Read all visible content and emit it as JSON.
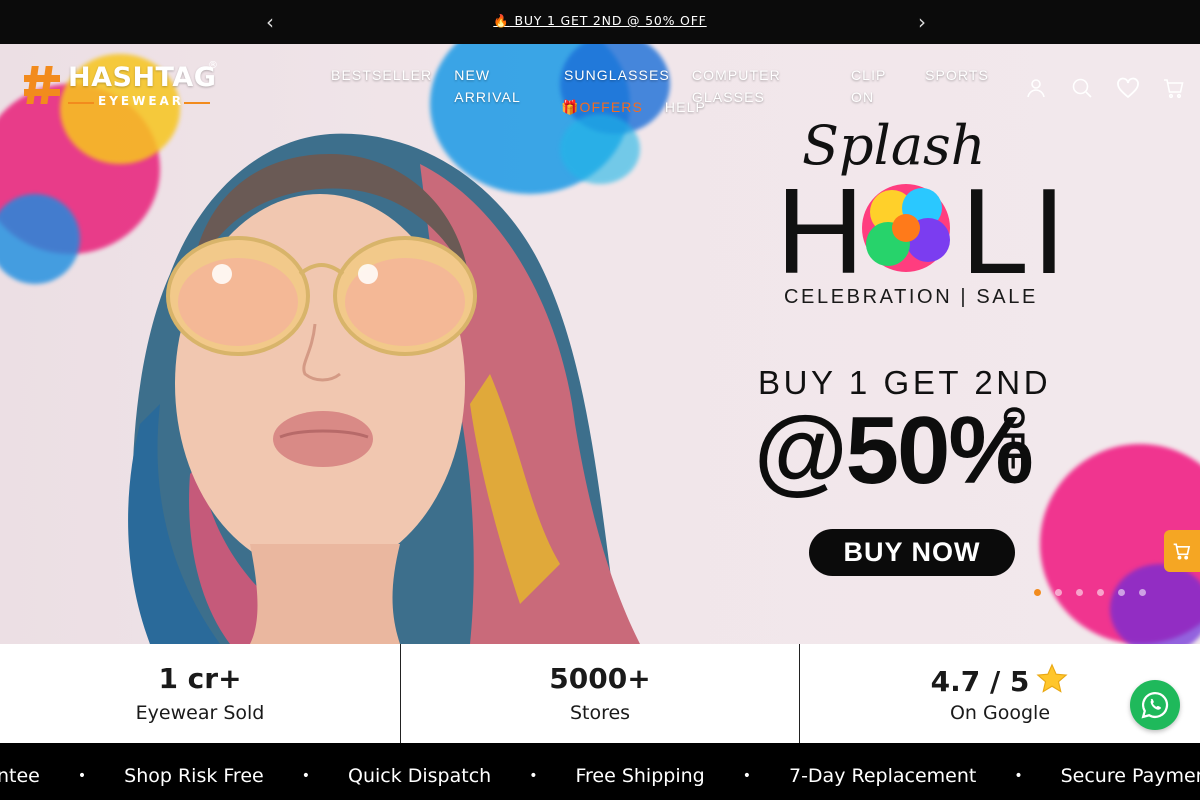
{
  "announcement": {
    "emoji": "🔥",
    "text": "BUY 1 GET 2ND @ 50% OFF",
    "prev_icon": "chevron-left-icon",
    "next_icon": "chevron-right-icon"
  },
  "brand": {
    "name": "HASHTAG",
    "registered": "®",
    "sub": "EYEWEAR",
    "accent": "#f28b1d"
  },
  "nav": {
    "row1": [
      "BESTSELLER",
      "NEW ARRIVAL",
      "SUNGLASSES",
      "COMPUTER GLASSES",
      "CLIP ON",
      "SPORTS"
    ],
    "offers": "🎁OFFERS",
    "help": "HELP"
  },
  "header_icons": [
    "account-icon",
    "search-icon",
    "wishlist-heart-icon",
    "cart-icon"
  ],
  "hero": {
    "splash": "Splash",
    "holi_letters": [
      "H",
      "L",
      "I"
    ],
    "celebration": "CELEBRATION | SALE",
    "offer_line": "BUY 1 GET 2ND",
    "discount": "@50%",
    "off": "OFF",
    "cta": "BUY NOW",
    "slides_count": 6,
    "active_slide": 1
  },
  "stats": [
    {
      "value": "1 cr+",
      "label": "Eyewear Sold"
    },
    {
      "value": "5000+",
      "label": "Stores"
    },
    {
      "value": "4.7 / 5",
      "label": "On Google",
      "icon": "star-icon"
    }
  ],
  "marquee": [
    "ntee",
    "Shop Risk Free",
    "Quick Dispatch",
    "Free Shipping",
    "7-Day Replacement",
    "Secure Payment Gatew"
  ],
  "colors": {
    "announcement_bg": "#0b0b0b",
    "offers": "#f36b21",
    "whatsapp": "#1fb95b",
    "side_cart": "#f5a623"
  }
}
